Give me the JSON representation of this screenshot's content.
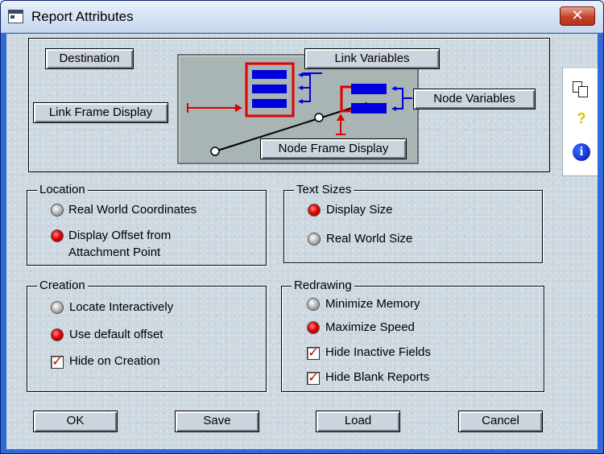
{
  "window": {
    "title": "Report Attributes",
    "close_label": "✕"
  },
  "sidebar": {
    "icons": [
      "copy-icon",
      "help-icon",
      "info-icon"
    ],
    "help_glyph": "?",
    "info_glyph": "i"
  },
  "diagram": {
    "destination": "Destination",
    "link_variables": "Link Variables",
    "link_frame_display": "Link Frame Display",
    "node_variables": "Node Variables",
    "node_frame_display": "Node Frame Display",
    "accent_red": "#e00000",
    "accent_blue": "#0000dd"
  },
  "location": {
    "title": "Location",
    "options": [
      "Real World Coordinates",
      "Display Offset from",
      "Attachment Point"
    ],
    "selected": "Display Offset from Attachment Point"
  },
  "text_sizes": {
    "title": "Text Sizes",
    "options": [
      "Display Size",
      "Real World Size"
    ],
    "selected": "Display Size"
  },
  "creation": {
    "title": "Creation",
    "options": [
      "Locate Interactively",
      "Use default offset"
    ],
    "selected": "Use default offset",
    "checkbox": "Hide on Creation",
    "checkbox_checked": true
  },
  "redrawing": {
    "title": "Redrawing",
    "options": [
      "Minimize Memory",
      "Maximize Speed"
    ],
    "selected": "Maximize Speed",
    "checkboxes": [
      "Hide Inactive Fields",
      "Hide Blank Reports"
    ],
    "checked": [
      true,
      true
    ]
  },
  "buttons": {
    "ok": "OK",
    "save": "Save",
    "load": "Load",
    "cancel": "Cancel"
  }
}
